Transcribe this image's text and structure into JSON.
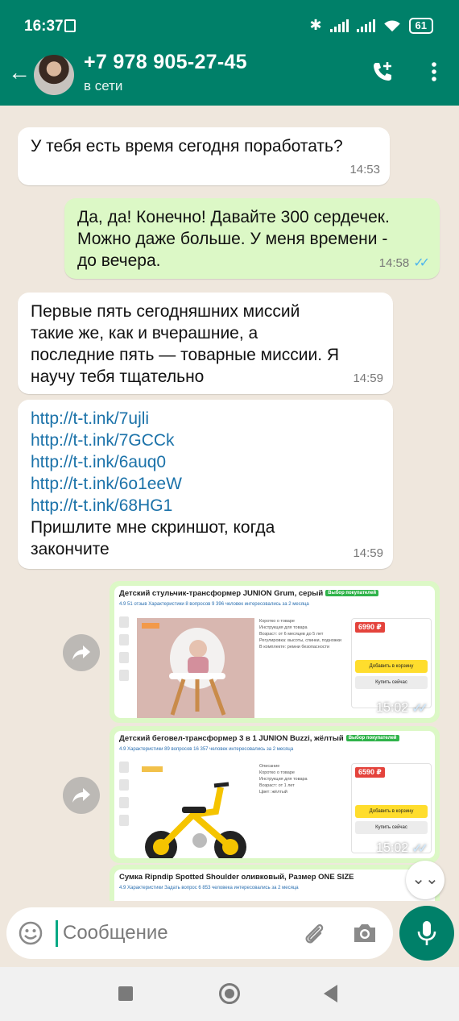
{
  "status_bar": {
    "time": "16:37",
    "battery": "61"
  },
  "header": {
    "contact_name": "+7 978 905-27-45",
    "contact_status": "в сети"
  },
  "messages": [
    {
      "direction": "in",
      "text": "У тебя есть время сегодня поработать?",
      "time": "14:53"
    },
    {
      "direction": "out",
      "lines": [
        "Да, да! Конечно! Давайте 300 сердечек.",
        "Можно даже больше. У меня времени -",
        "до вечера."
      ],
      "time": "14:58",
      "status": "read"
    },
    {
      "direction": "in",
      "lines": [
        "Первые пять сегодняшних миссий",
        "такие же, как и вчерашние, а",
        "последние пять — товарные миссии. Я",
        "научу тебя тщательно"
      ],
      "time": "14:59"
    },
    {
      "direction": "in",
      "links": [
        "http://t-t.ink/7ujli",
        "http://t-t.ink/7GCCk",
        "http://t-t.ink/6auq0",
        "http://t-t.ink/6o1eeW",
        "http://t-t.ink/68HG1"
      ],
      "text": "Пришлите мне скриншот, когда",
      "text2": "закончите",
      "time": "14:59"
    }
  ],
  "media": [
    {
      "title": "Детский стульчик-трансформер JUNION Grum, серый",
      "badge": "Выбор покупателей",
      "meta": "4.9   51 отзыв   Характеристики   8 вопросов   9 396 человек интересовались за 2 месяца",
      "price": "6990 ₽",
      "specs": [
        "Коротко о товаре",
        "Инструкция для товара",
        "Возраст: от 6 месяцев до 5 лет",
        "Регулировка: высоты, спинки, подножки",
        "В комплекте: ремни безопасности"
      ],
      "add_to_cart": "Добавить в корзину",
      "buy_now": "Купить сейчас",
      "time": "15:02"
    },
    {
      "title": "Детский беговел-трансформер 3 в 1 JUNION Buzzi, жёлтый",
      "badge": "Выбор покупателей",
      "meta": "4.9   Характеристики   89 вопросов   16 357 человек интересовались за 2 месяца",
      "price": "6590 ₽",
      "specs": [
        "Описание",
        "Коротко о товаре",
        "Инструкция для товара",
        "Возраст: от 1 лет",
        "Цвет: жёлтый"
      ],
      "add_to_cart": "Добавить в корзину",
      "buy_now": "Купить сейчас",
      "time": "15:02"
    },
    {
      "title": "Сумка Ripndip Spotted Shoulder оливковый, Размер ONE SIZE",
      "meta": "4.9   Характеристики   Задать вопрос   6 853 человека интересовались за 2 месяца"
    }
  ],
  "input": {
    "placeholder": "Сообщение"
  },
  "colors": {
    "header": "#008069",
    "outgoing": "#dcf8c6",
    "incoming": "#ffffff",
    "link": "#1b72a9",
    "read_ticks": "#4fb6ec"
  }
}
